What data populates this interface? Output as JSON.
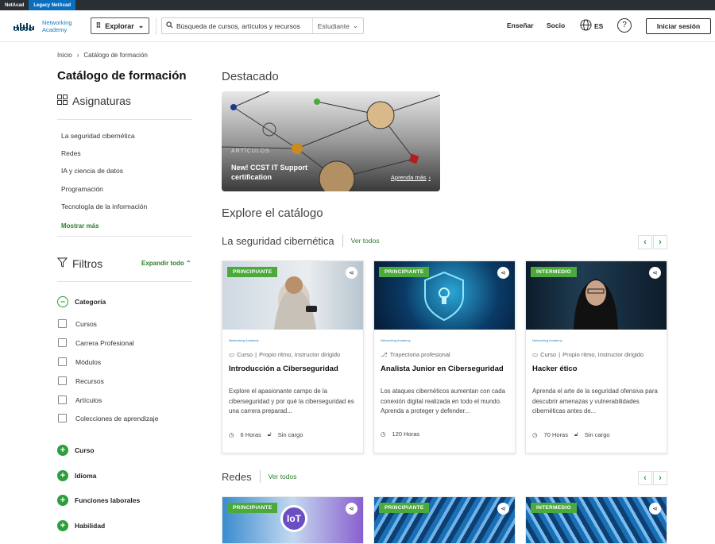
{
  "topbar": {
    "tab1": "NetAcad",
    "tab2": "Legacy NetAcad"
  },
  "header": {
    "brand": "CISCO",
    "product_line1": "Networking",
    "product_line2": "Academy",
    "explore": "Explorar",
    "search_placeholder": "Búsqueda de cursos, artículos y recursos",
    "role": "Estudiante",
    "teach": "Enseñar",
    "partner": "Socio",
    "lang": "ES",
    "help": "?",
    "signin": "Iniciar sesión"
  },
  "breadcrumb": {
    "home": "Inicio",
    "current": "Catálogo de formación"
  },
  "sidebar": {
    "title": "Catálogo de formación",
    "subjects_heading": "Asignaturas",
    "subjects": [
      "La seguridad cibernética",
      "Redes",
      "IA y ciencia de datos",
      "Programación",
      "Tecnología de la información"
    ],
    "show_more": "Mostrar más",
    "filters_heading": "Filtros",
    "expand_all": "Expandir todo",
    "category_label": "Categoría",
    "category_options": [
      "Cursos",
      "Carrera Profesional",
      "Módulos",
      "Recursos",
      "Artículos",
      "Colecciones de aprendizaje"
    ],
    "groups": [
      "Curso",
      "Idioma",
      "Funciones laborales",
      "Habilidad"
    ]
  },
  "featured": {
    "heading": "Destacado",
    "label": "ARTÍCULOS",
    "title": "New! CCST IT Support certification",
    "link": "Aprenda más"
  },
  "explore_heading": "Explore el catálogo",
  "rows": [
    {
      "title": "La seguridad cibernética",
      "view_all": "Ver todos",
      "cards": [
        {
          "level": "PRINCIPIANTE",
          "type": "Curso",
          "meta": "Propio ritmo, Instructor dirigido",
          "title": "Introducción a Ciberseguridad",
          "desc": "Explore el apasionante campo de la ciberseguridad y por qué la ciberseguridad es una carrera preparad...",
          "hours": "6 Horas",
          "cost": "Sin cargo"
        },
        {
          "level": "PRINCIPIANTE",
          "type": "",
          "meta": "Trayectoria profesional",
          "title": "Analista Junior en Ciberseguridad",
          "desc": "Los ataques cibernéticos aumentan con cada conexión digital realizada en todo el mundo. Aprenda a proteger y defender...",
          "hours": "120 Horas",
          "cost": ""
        },
        {
          "level": "INTERMEDIO",
          "type": "Curso",
          "meta": "Propio ritmo, Instructor dirigido",
          "title": "Hacker ético",
          "desc": "Aprenda el arte de la seguridad ofensiva para descubrir amenazas y vulnerabilidades cibernéticas antes de...",
          "hours": "70 Horas",
          "cost": "Sin cargo"
        }
      ]
    },
    {
      "title": "Redes",
      "view_all": "Ver todos",
      "cards": [
        {
          "level": "PRINCIPIANTE",
          "img_text": "IoT"
        },
        {
          "level": "PRINCIPIANTE"
        },
        {
          "level": "INTERMEDIO"
        }
      ]
    }
  ],
  "card_logo": "Networking Academy"
}
